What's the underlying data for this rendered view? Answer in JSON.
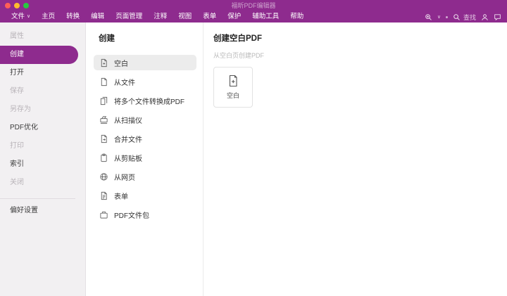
{
  "colors": {
    "accent": "#8E2B8E",
    "titlebar": "#8E2B8E",
    "sidebar_bg": "#F2F0F2",
    "selected_row_bg": "#ECECEC",
    "traffic_red": "#FF5F57",
    "traffic_yellow": "#FEBC2E",
    "traffic_green": "#28C840"
  },
  "titlebar": {
    "title": "福昕PDF编辑器"
  },
  "menubar": {
    "items": [
      "文件",
      "主页",
      "转换",
      "编辑",
      "页面管理",
      "注释",
      "视图",
      "表单",
      "保护",
      "辅助工具",
      "帮助"
    ],
    "file_chevron": "∨",
    "right": {
      "zoom_chevron": "∨",
      "find_label": "查找",
      "icons": [
        "zoom-tools-icon",
        "search-icon",
        "account-icon",
        "chat-icon"
      ]
    }
  },
  "sidebar": {
    "items": [
      {
        "label": "属性",
        "state": "disabled"
      },
      {
        "label": "创建",
        "state": "selected"
      },
      {
        "label": "打开",
        "state": "enabled"
      },
      {
        "label": "保存",
        "state": "disabled"
      },
      {
        "label": "另存为",
        "state": "disabled"
      },
      {
        "label": "PDF优化",
        "state": "enabled"
      },
      {
        "label": "打印",
        "state": "disabled"
      },
      {
        "label": "索引",
        "state": "enabled"
      },
      {
        "label": "关闭",
        "state": "disabled"
      }
    ],
    "preferences": {
      "label": "偏好设置"
    }
  },
  "create_panel": {
    "title": "创建",
    "items": [
      {
        "label": "空白",
        "icon": "blank-doc-icon",
        "selected": true
      },
      {
        "label": "从文件",
        "icon": "file-icon",
        "selected": false
      },
      {
        "label": "将多个文件转换成PDF",
        "icon": "multiple-files-icon",
        "selected": false
      },
      {
        "label": "从扫描仪",
        "icon": "scanner-icon",
        "selected": false
      },
      {
        "label": "合并文件",
        "icon": "combine-files-icon",
        "selected": false
      },
      {
        "label": "从剪贴板",
        "icon": "clipboard-icon",
        "selected": false
      },
      {
        "label": "从网页",
        "icon": "web-icon",
        "selected": false
      },
      {
        "label": "表单",
        "icon": "form-icon",
        "selected": false
      },
      {
        "label": "PDF文件包",
        "icon": "portfolio-icon",
        "selected": false
      }
    ]
  },
  "detail_panel": {
    "title": "创建空白PDF",
    "subtitle": "从空白页创建PDF",
    "card": {
      "label": "空白",
      "icon": "new-blank-doc-icon"
    }
  }
}
